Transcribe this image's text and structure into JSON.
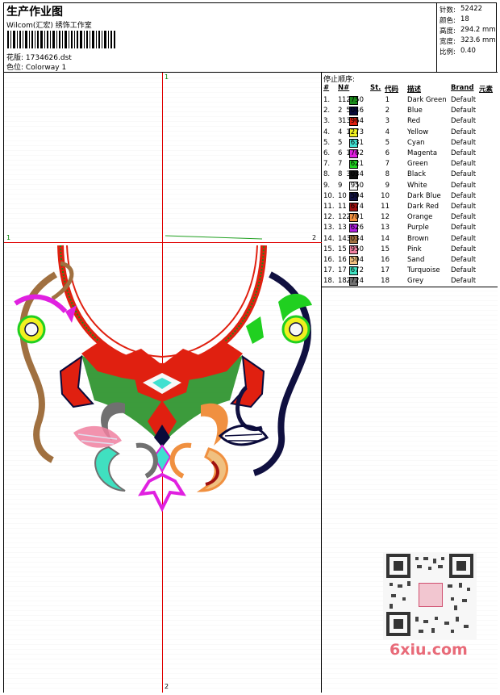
{
  "header": {
    "title": "生产作业图",
    "company": "Wilcom(汇宏) 绣饰工作室",
    "design_label": "花版:",
    "design_value": "1734626.dst",
    "colorway_label": "色位:",
    "colorway_value": "Colorway 1"
  },
  "stats": [
    {
      "label": "针数:",
      "value": "52422"
    },
    {
      "label": "颜色:",
      "value": "18"
    },
    {
      "label": "高度:",
      "value": "294.2 mm"
    },
    {
      "label": "宽度:",
      "value": "323.6 mm"
    },
    {
      "label": "比例:",
      "value": "0.40"
    }
  ],
  "table": {
    "title": "停止顺序:",
    "headers": {
      "num": "#",
      "needle": "N#",
      "st": "St.",
      "code": "代码",
      "desc": "描述",
      "brand": "Brand",
      "element": "元素"
    },
    "rows": [
      {
        "num": "1.",
        "needle": "1",
        "color": "#1a8a1a",
        "st": "12750",
        "code": "1",
        "desc": "Dark Green",
        "brand": "Default"
      },
      {
        "num": "2.",
        "needle": "2",
        "color": "#0a0a3a",
        "st": "5046",
        "code": "2",
        "desc": "Blue",
        "brand": "Default"
      },
      {
        "num": "3.",
        "needle": "3",
        "color": "#e02010",
        "st": "13964",
        "code": "3",
        "desc": "Red",
        "brand": "Default"
      },
      {
        "num": "4.",
        "needle": "4",
        "color": "#f0f020",
        "st": "1273",
        "code": "4",
        "desc": "Yellow",
        "brand": "Default"
      },
      {
        "num": "5.",
        "needle": "5",
        "color": "#40e0d0",
        "st": "631",
        "code": "5",
        "desc": "Cyan",
        "brand": "Default"
      },
      {
        "num": "6.",
        "needle": "6",
        "color": "#e020e0",
        "st": "1762",
        "code": "6",
        "desc": "Magenta",
        "brand": "Default"
      },
      {
        "num": "7.",
        "needle": "7",
        "color": "#20d020",
        "st": "621",
        "code": "7",
        "desc": "Green",
        "brand": "Default"
      },
      {
        "num": "8.",
        "needle": "8",
        "color": "#101010",
        "st": "3034",
        "code": "8",
        "desc": "Black",
        "brand": "Default"
      },
      {
        "num": "9.",
        "needle": "9",
        "color": "#f8f8f8",
        "st": "950",
        "code": "9",
        "desc": "White",
        "brand": "Default"
      },
      {
        "num": "10.",
        "needle": "10",
        "color": "#101040",
        "st": "504",
        "code": "10",
        "desc": "Dark Blue",
        "brand": "Default"
      },
      {
        "num": "11.",
        "needle": "11",
        "color": "#a01010",
        "st": "674",
        "code": "11",
        "desc": "Dark Red",
        "brand": "Default"
      },
      {
        "num": "12.",
        "needle": "12",
        "color": "#f09040",
        "st": "2701",
        "code": "12",
        "desc": "Orange",
        "brand": "Default"
      },
      {
        "num": "13.",
        "needle": "13",
        "color": "#b020e0",
        "st": "626",
        "code": "13",
        "desc": "Purple",
        "brand": "Default"
      },
      {
        "num": "14.",
        "needle": "14",
        "color": "#a07040",
        "st": "3034",
        "code": "14",
        "desc": "Brown",
        "brand": "Default"
      },
      {
        "num": "15.",
        "needle": "15",
        "color": "#f080a0",
        "st": "950",
        "code": "15",
        "desc": "Pink",
        "brand": "Default"
      },
      {
        "num": "16.",
        "needle": "16",
        "color": "#f0c080",
        "st": "504",
        "code": "16",
        "desc": "Sand",
        "brand": "Default"
      },
      {
        "num": "17.",
        "needle": "17",
        "color": "#40e0c0",
        "st": "672",
        "code": "17",
        "desc": "Turquoise",
        "brand": "Default"
      },
      {
        "num": "18.",
        "needle": "18",
        "color": "#707070",
        "st": "2724",
        "code": "18",
        "desc": "Grey",
        "brand": "Default"
      }
    ]
  },
  "markers": {
    "top": "1",
    "left": "1",
    "right": "2",
    "bottom": "2"
  },
  "watermark": "6xiu.com"
}
